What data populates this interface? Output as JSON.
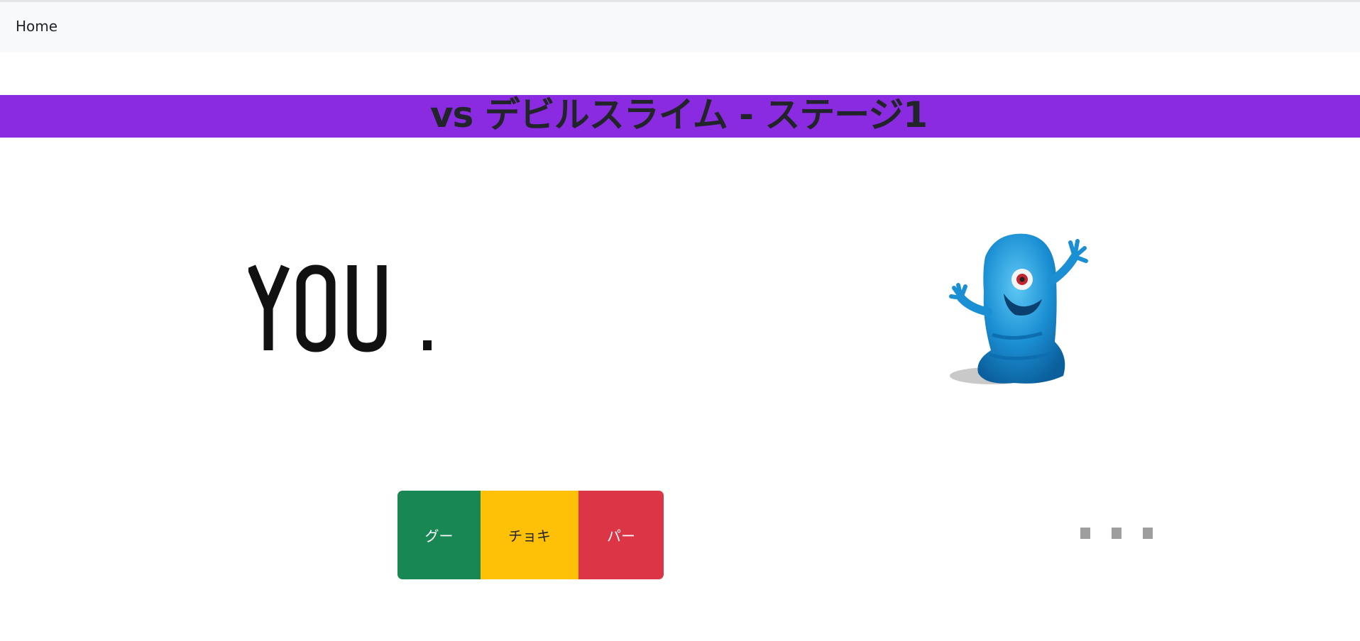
{
  "navbar": {
    "home_label": "Home"
  },
  "battle": {
    "title": "vs デビルスライム - ステージ1",
    "title_bar_color": "#8a2be2",
    "player_logo_text": "YOU.",
    "opponent_image": "blue-one-eyed-slime-monster",
    "opponent_status": "・・・"
  },
  "hands": [
    {
      "label": "グー",
      "color": "#198754"
    },
    {
      "label": "チョキ",
      "color": "#ffc107"
    },
    {
      "label": "パー",
      "color": "#dc3545"
    }
  ]
}
